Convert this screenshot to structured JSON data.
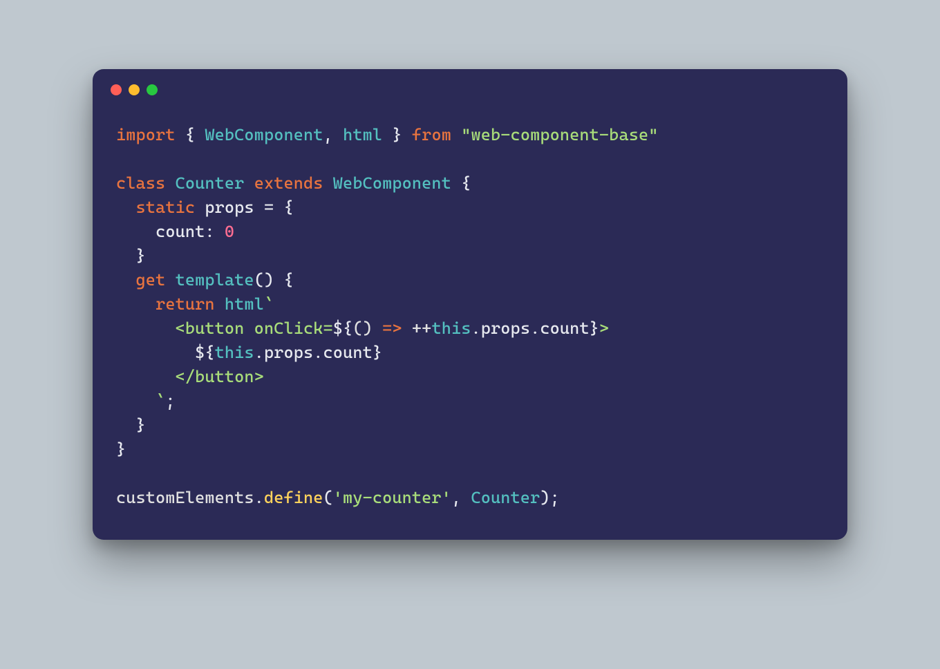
{
  "window": {
    "buttons": [
      "close",
      "minimize",
      "zoom"
    ]
  },
  "code": {
    "l1": {
      "kw_import": "import",
      "op_braceL": " { ",
      "id1": "WebComponent",
      "comma": ", ",
      "id2": "html",
      "op_braceR": " } ",
      "kw_from": "from",
      "sp": " ",
      "str_pkg": "\"web-component-base\""
    },
    "blank1": "",
    "l2": {
      "kw_class": "class",
      "sp1": " ",
      "cls_name": "Counter",
      "sp2": " ",
      "kw_extends": "extends",
      "sp3": " ",
      "super": "WebComponent",
      "sp4": " ",
      "brace": "{"
    },
    "l3": {
      "indent": "  ",
      "kw_static": "static",
      "sp": " ",
      "id_props": "props",
      "eq": " = {"
    },
    "l4": {
      "indent": "    ",
      "key": "count",
      "colon": ": ",
      "num": "0"
    },
    "l5": {
      "indent": "  ",
      "brace": "}"
    },
    "l6": {
      "indent": "  ",
      "kw_get": "get",
      "sp": " ",
      "name": "template",
      "parens": "() {"
    },
    "l7": {
      "indent": "    ",
      "kw_return": "return",
      "sp": " ",
      "tag": "html",
      "tick": "`"
    },
    "l8": {
      "indent": "      ",
      "open1": "<button onClick=",
      "dollar": "${",
      "arrow_l": "() ",
      "arrow": "=>",
      "arrow_r": " ++",
      "this": "this",
      "dot1": ".",
      "props": "props",
      "dot2": ".",
      "count": "count",
      "closeexpr": "}",
      "gt": ">"
    },
    "l9": {
      "indent": "        ",
      "dollar": "${",
      "this": "this",
      "dot1": ".",
      "props": "props",
      "dot2": ".",
      "count": "count",
      "close": "}"
    },
    "l10": {
      "indent": "      ",
      "close": "</button>"
    },
    "l11": {
      "indent": "    ",
      "tick": "`",
      "semi": ";"
    },
    "l12": {
      "indent": "  ",
      "brace": "}"
    },
    "l13": {
      "brace": "}"
    },
    "blank2": "",
    "l14": {
      "obj": "customElements",
      "dot": ".",
      "fn": "define",
      "lp": "(",
      "str": "'my-counter'",
      "comma": ", ",
      "arg": "Counter",
      "rp": ");"
    }
  }
}
